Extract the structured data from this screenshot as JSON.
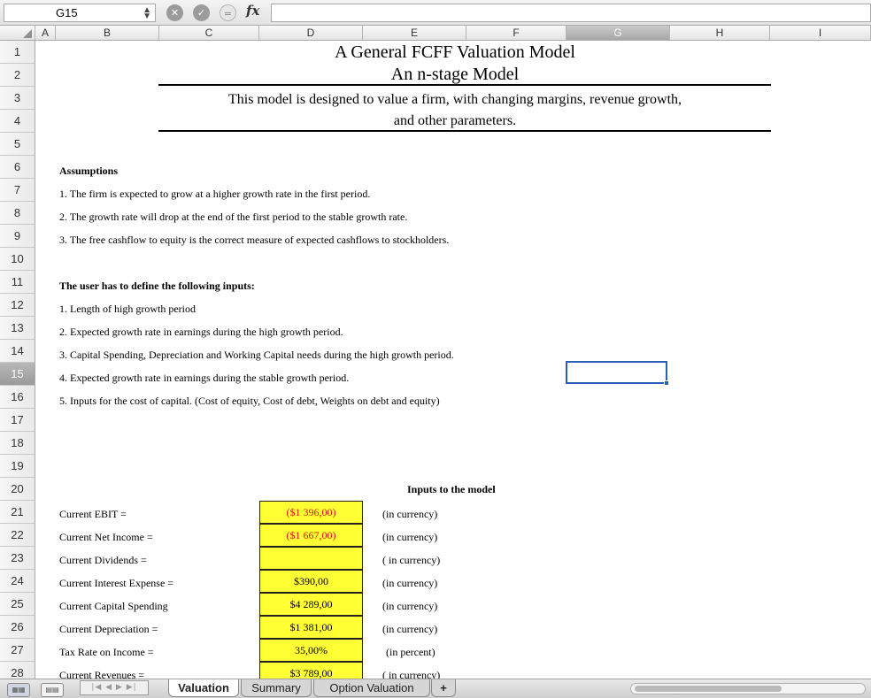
{
  "formula_bar": {
    "name_box": "G15",
    "fx_label": "fx",
    "formula": ""
  },
  "columns": [
    "A",
    "B",
    "C",
    "D",
    "E",
    "F",
    "G",
    "H",
    "I"
  ],
  "selected_column": "G",
  "rows": [
    "1",
    "2",
    "3",
    "4",
    "5",
    "6",
    "7",
    "8",
    "9",
    "10",
    "11",
    "12",
    "13",
    "14",
    "15",
    "16",
    "17",
    "18",
    "19",
    "20",
    "21",
    "22",
    "23",
    "24",
    "25",
    "26",
    "27",
    "28"
  ],
  "selected_row": "15",
  "sheet": {
    "title1": "A General FCFF Valuation Model",
    "title2": "An n-stage Model",
    "desc1": "This model is designed to value a firm, with changing margins, revenue growth,",
    "desc2": "and other parameters.",
    "assumptions_heading": "Assumptions",
    "assumptions": [
      "1. The firm is expected to grow at a higher growth rate in the first period.",
      "2. The growth rate will drop at the end of the first period to the stable growth rate.",
      "3. The free cashflow to equity is the correct measure of expected cashflows to stockholders."
    ],
    "inputs_heading": "The user has to define the following inputs:",
    "inputs_list": [
      "1. Length of high growth period",
      "2. Expected growth rate in earnings during the high growth period.",
      "3. Capital Spending, Depreciation and Working Capital needs during the high growth period.",
      "4. Expected growth rate in earnings during the stable growth period.",
      "5. Inputs for the cost of capital. (Cost of equity, Cost of debt, Weights on debt and equity)"
    ],
    "model_inputs_heading": "Inputs to the model",
    "model_inputs": [
      {
        "label": "Current EBIT =",
        "value": "($1 396,00)",
        "unit": "(in currency)",
        "negative": true
      },
      {
        "label": "Current Net Income =",
        "value": "($1 667,00)",
        "unit": "(in currency)",
        "negative": true
      },
      {
        "label": "Current Dividends =",
        "value": "",
        "unit": "( in currency)",
        "negative": false
      },
      {
        "label": "Current Interest Expense =",
        "value": "$390,00",
        "unit": "(in currency)",
        "negative": false
      },
      {
        "label": "Current Capital Spending",
        "value": "$4 289,00",
        "unit": "(in currency)",
        "negative": false
      },
      {
        "label": "Current Depreciation =",
        "value": "$1 381,00",
        "unit": "(in currency)",
        "negative": false
      },
      {
        "label": "Tax Rate on Income =",
        "value": "35,00%",
        "unit": "(in percent)",
        "negative": false
      },
      {
        "label": "Current Revenues =",
        "value": "$3 789,00",
        "unit": "( in currency)",
        "negative": false
      }
    ]
  },
  "tabs": {
    "nav": "|◀ ◀ ▶ ▶|",
    "sheets": [
      "Valuation",
      "Summary",
      "Option Valuation"
    ],
    "active": "Valuation",
    "add": "+"
  },
  "view_buttons": {
    "normal": "▦▦",
    "layout": "▤▤"
  }
}
